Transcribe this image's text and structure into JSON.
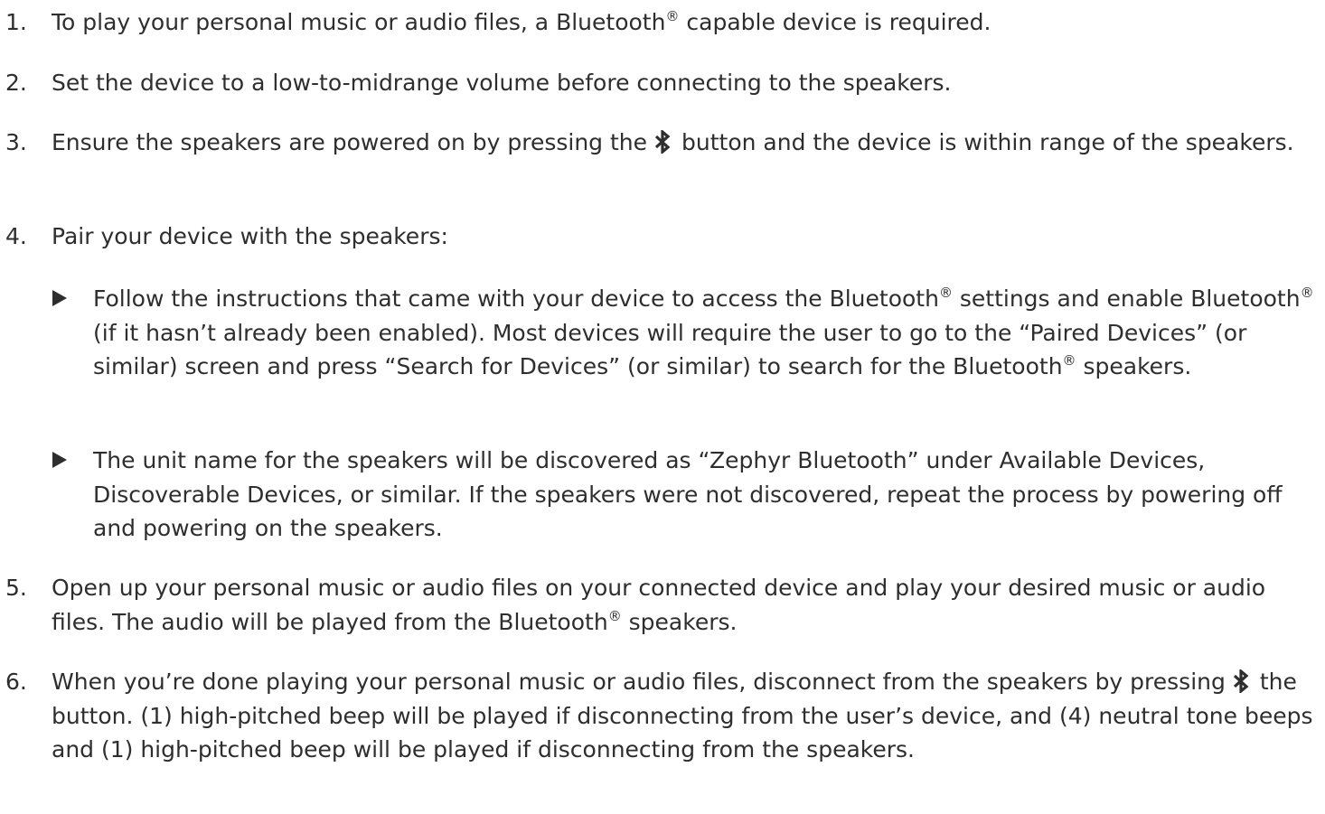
{
  "steps": [
    {
      "num": "1.",
      "text_a": "To play your personal music or audio files, a Bluetooth",
      "reg": "®",
      "text_b": " capable device is required."
    },
    {
      "num": "2.",
      "text": "Set the device to a low-to-midrange volume before connecting to the speakers."
    },
    {
      "num": "3.",
      "text_a": "Ensure the speakers are powered on by pressing the",
      "text_b": "button and the device is within range of the speakers."
    },
    {
      "num": "4.",
      "text": "Pair your device with the speakers:"
    },
    {
      "num": "5.",
      "text_a": "Open up your personal music or audio files on your connected device and play your desired music or audio files. The audio will be played from the Bluetooth",
      "reg": "®",
      "text_b": " speakers."
    },
    {
      "num": "6.",
      "text_a": "When you’re done playing your personal music or audio files, disconnect from the speakers by pressing",
      "text_b": "the button. (1) high-pitched beep will be played if disconnecting from the user’s device, and (4) neutral tone beeps and (1) high-pitched beep will be played if disconnecting from the speakers."
    }
  ],
  "substeps": [
    {
      "p1": "Follow the instructions that came with your device to access the Bluetooth",
      "reg1": "®",
      "p2": "  settings and enable Bluetooth",
      "reg2": "®",
      "p3": " (if it hasn’t already been enabled).  Most devices will require the user to go to the “Paired Devices” (or similar) screen and press “Search for Devices” (or similar) to search for the Bluetooth",
      "reg3": "®",
      "p4": " speakers."
    },
    {
      "text": "The unit name for the speakers will be discovered as “Zephyr Bluetooth” under Available Devices, Discoverable Devices, or similar. If the speakers were not discovered, repeat the process by powering off and powering on the speakers."
    }
  ],
  "icons": {
    "bluetooth": "bluetooth-icon",
    "bullet": "triangle-right-icon"
  },
  "colors": {
    "text": "#2e2e2e",
    "background": "#ffffff"
  }
}
